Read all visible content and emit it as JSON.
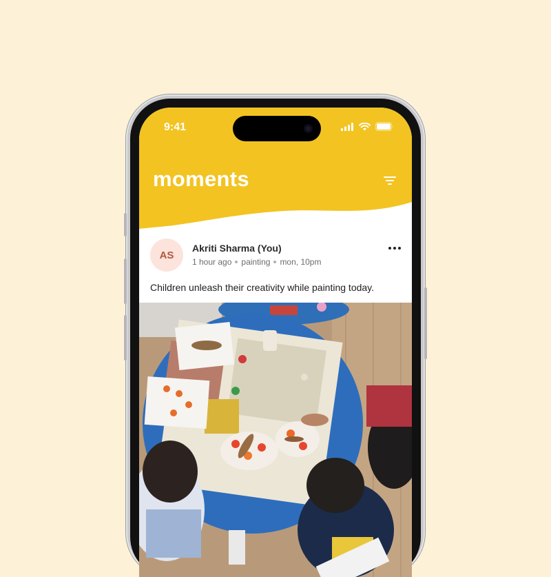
{
  "status_bar": {
    "time": "9:41"
  },
  "header": {
    "title": "moments",
    "accent_color": "#f3c321"
  },
  "post": {
    "avatar_initials": "AS",
    "author": "Akriti Sharma (You)",
    "relative_time": "1 hour ago",
    "category": "painting",
    "timestamp": "mon, 10pm",
    "caption": "Children unleash their creativity while painting today.",
    "icons": {
      "menu": "more-horizontal-icon",
      "filter": "filter-icon"
    }
  }
}
